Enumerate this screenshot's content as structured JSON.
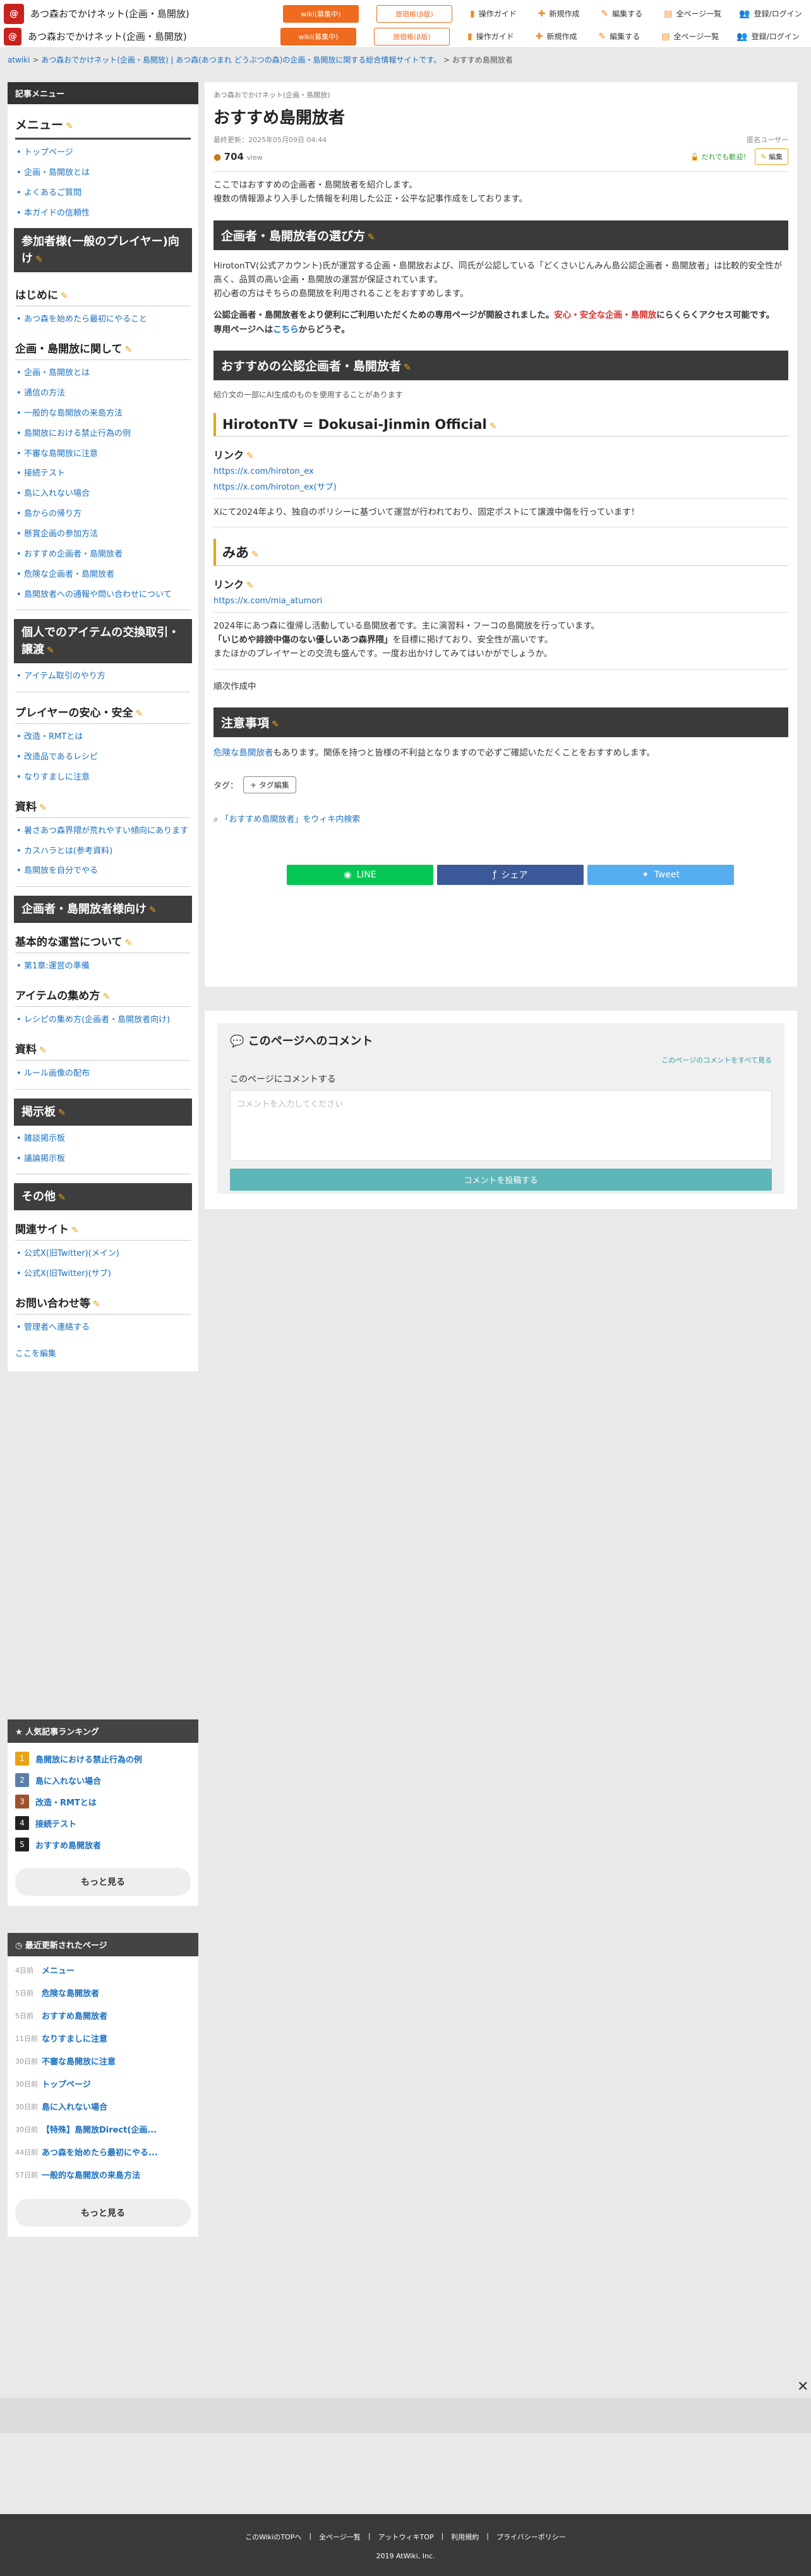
{
  "header": {
    "logo_text": "@",
    "site_title": "あつ森おでかけネット(企画・島開放)",
    "wiki_recruit": "wiki(募集中)",
    "recruit_btn": "旅宿帳(β版)",
    "items": [
      "操作ガイド",
      "新規作成",
      "編集する",
      "全ページ一覧",
      "登録/ログイン"
    ]
  },
  "breadcrumb": {
    "root": "atwiki",
    "parent": "あつ森おでかけネット(企画・島開放) | あつ森(あつまれ どうぶつの森)の企画・島開放に関する総合情報サイトです。",
    "current": "おすすめ島開放者"
  },
  "sidebar": {
    "header": "記事メニュー",
    "menu_title": "メニュー",
    "menu_items": [
      "トップページ",
      "企画・島開放とは",
      "よくあるご質問",
      "本ガイドの信頼性"
    ],
    "section_general": "参加者様(一般のプレイヤー)向け",
    "hajime_title": "はじめに",
    "hajime_items": [
      "あつ森を始めたら最初にやること"
    ],
    "kikaku_title": "企画・島開放に関して",
    "kikaku_items": [
      "企画・島開放とは",
      "通信の方法",
      "一般的な島開放の来島方法",
      "島開放における禁止行為の例",
      "不審な島開放に注意",
      "接続テスト",
      "島に入れない場合",
      "島からの帰り方",
      "懸賞企画の参加方法",
      "おすすめ企画者・島開放者",
      "危険な企画者・島開放者",
      "島開放者への通報や問い合わせについて"
    ],
    "item_title": "個人でのアイテムの交換取引・譲渡",
    "item_items": [
      "アイテム取引のやり方"
    ],
    "safe_title": "プレイヤーの安心・安全",
    "safe_items": [
      "改造・RMTとは",
      "改造品であるレシピ",
      "なりすましに注意"
    ],
    "shiryo_title": "資料",
    "shiryo_items": [
      "暑さあつ森界隈が荒れやすい傾向にあります",
      "カスハラとは(参考資料)",
      "島開放を自分でやる"
    ],
    "section_host": "企画者・島開放者様向け",
    "basic_title": "基本的な運営について",
    "basic_items": [
      "第1章:運営の準備"
    ],
    "gather_title": "アイテムの集め方",
    "gather_items": [
      "レシピの集め方(企画者・島開放者向け)"
    ],
    "shiryo2_title": "資料",
    "shiryo2_items": [
      "ルール画像の配布"
    ],
    "bbs_title": "掲示板",
    "bbs_items": [
      "雑談掲示板",
      "議論掲示板"
    ],
    "other_title": "その他",
    "related_title": "関連サイト",
    "related_items": [
      "公式X(旧Twitter)(メイン)",
      "公式X(旧Twitter)(サブ)"
    ],
    "contact_title": "お問い合わせ等",
    "contact_items": [
      "管理者へ連絡する"
    ],
    "edit_here": "ここを編集"
  },
  "ranking": {
    "header": "人気記事ランキング",
    "items": [
      {
        "rank": "1",
        "title": "島開放における禁止行為の例",
        "color": "#e8a317"
      },
      {
        "rank": "2",
        "title": "島に入れない場合",
        "color": "#5a7fa8"
      },
      {
        "rank": "3",
        "title": "改造・RMTとは",
        "color": "#a0522d"
      },
      {
        "rank": "4",
        "title": "接続テスト",
        "color": "#222222"
      },
      {
        "rank": "5",
        "title": "おすすめ島開放者",
        "color": "#222222"
      }
    ],
    "more": "もっと見る"
  },
  "recent": {
    "header": "最近更新されたページ",
    "items": [
      {
        "ago": "4日前",
        "title": "メニュー"
      },
      {
        "ago": "5日前",
        "title": "危険な島開放者"
      },
      {
        "ago": "5日前",
        "title": "おすすめ島開放者"
      },
      {
        "ago": "11日前",
        "title": "なりすましに注意"
      },
      {
        "ago": "30日前",
        "title": "不審な島開放に注意"
      },
      {
        "ago": "30日前",
        "title": "トップページ"
      },
      {
        "ago": "30日前",
        "title": "島に入れない場合"
      },
      {
        "ago": "30日前",
        "title": "【特殊】島開放Direct(企画..."
      },
      {
        "ago": "44日前",
        "title": "あつ森を始めたら最初にやる..."
      },
      {
        "ago": "57日前",
        "title": "一般的な島開放の来島方法"
      }
    ],
    "more": "もっと見る"
  },
  "main": {
    "category": "あつ森おでかけネット(企画・島開放)",
    "title": "おすすめ島開放者",
    "updated": "最終更新：2025年05月09日 04:44",
    "author": "匿名ユーザー",
    "views": "704",
    "views_unit": "view",
    "guest_edit": "だれでも歓迎！",
    "edit_btn": "編集",
    "intro1": "ここではおすすめの企画者・島開放者を紹介します。",
    "intro2": "複数の情報源より入手した情報を利用した公正・公平な記事作成をしております。",
    "h_choose": "企画者・島開放者の選び方",
    "choose_p1": "HirotonTV(公式アカウント)氏が運営する企画・島開放および、同氏が公認している「どくさいじんみん島公認企画者・島開放者」は比較的安全性が高く、品質の高い企画・島開放の運営が保証されています。",
    "choose_p2": "初心者の方はそちらの島開放を利用されることをおすすめします。",
    "choose_p3a": "公認企画者・島開放者をより便利にご利用いただくための専用ページが開設されました。",
    "choose_p3b": "安心・安全な企画・島開放",
    "choose_p3c": "にらくらくアクセス可能です。",
    "choose_p4a": "専用ページへは",
    "choose_p4b": "こちら",
    "choose_p4c": "からどうぞ。",
    "h_official": "おすすめの公認企画者・島開放者",
    "official_note": "紹介文の一部にAI生成のものを使用することがあります",
    "h_hiroton": "HirotonTV = Dokusai-Jinmin Official",
    "link_label": "リンク",
    "hiroton_link1": "https://x.com/hiroton_ex",
    "hiroton_link2": "https://x.com/hiroton_ex(サブ)",
    "hiroton_desc": "Xにて2024年より、独自のポリシーに基づいて運営が行われており、固定ポストにて譲渡中傷を行っています！",
    "h_mia": "みあ",
    "mia_link": "https://x.com/mia_atumori",
    "mia_p1": "2024年にあつ森に復帰し活動している島開放者です。主に演習料・フーコの島開放を行っています。",
    "mia_p2a": "「いじめや誹謗中傷のない優しいあつ森界隈」",
    "mia_p2b": "を目標に掲げており、安全性が高いです。",
    "mia_p3": "またほかのプレイヤーとの交流も盛んです。一度お出かけしてみてはいかがでしょうか。",
    "pending": "順次作成中",
    "h_caution": "注意事項",
    "caution_a": "危険な島開放者",
    "caution_b": "もあります。関係を持つと皆様の不利益となりますので必ずご確認いただくことをおすすめします。",
    "tag_label": "タグ：",
    "tag_btn": "+ タグ編集",
    "search_wiki": "「おすすめ島開放者」をウィキ内検索",
    "share_line": "LINE",
    "share_fb": "シェア",
    "share_tw": "Tweet"
  },
  "comments": {
    "title": "このページへのコメント",
    "all": "このページのコメントをすべて見る",
    "label": "このページにコメントする",
    "placeholder": "コメントを入力してください",
    "submit": "コメントを投稿する"
  },
  "footer": {
    "links": [
      "このWikiのTOPへ",
      "全ページ一覧",
      "アットウィキTOP",
      "利用規約",
      "プライバシーポリシー"
    ],
    "copy": "2019 AtWiki, Inc."
  },
  "colors": {
    "accent": "#ef6b1f",
    "link": "#1a6fbf",
    "line": "#06c755",
    "facebook": "#3b5998",
    "twitter": "#55acee"
  }
}
